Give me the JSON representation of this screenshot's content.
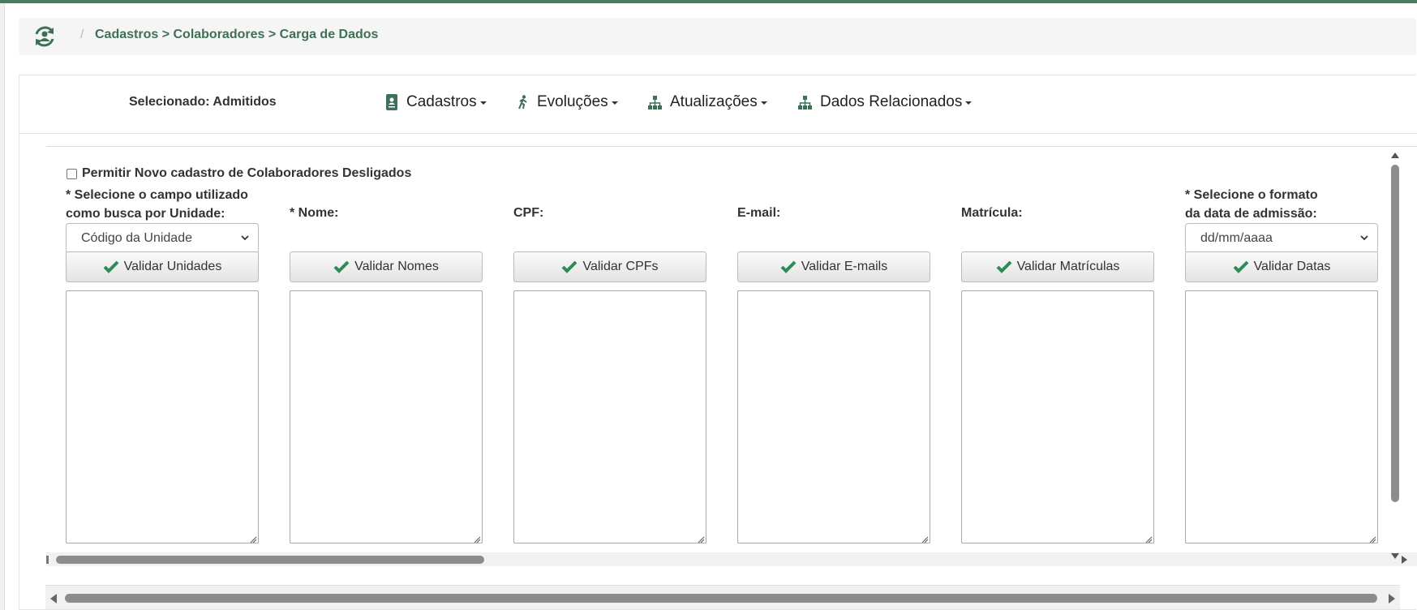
{
  "breadcrumb": {
    "separator": "/",
    "path": "Cadastros > Colaboradores > Carga de Dados"
  },
  "nav": {
    "selected_label": "Selecionado: Admitidos",
    "menus": [
      {
        "label": "Cadastros",
        "icon": "address-book-icon"
      },
      {
        "label": "Evoluções",
        "icon": "person-walking-icon"
      },
      {
        "label": "Atualizações",
        "icon": "sitemap-icon"
      },
      {
        "label": "Dados Relacionados",
        "icon": "sitemap-icon"
      }
    ]
  },
  "form": {
    "allow_dismissed_label": "Permitir Novo cadastro de Colaboradores Desligados",
    "allow_dismissed_checked": false,
    "columns": [
      {
        "label": "* Selecione o campo utilizado\ncomo busca por Unidade:",
        "select_value": "Código da Unidade",
        "button": "Validar Unidades",
        "textarea_value": ""
      },
      {
        "label": "* Nome:",
        "button": "Validar Nomes",
        "textarea_value": ""
      },
      {
        "label": "CPF:",
        "button": "Validar CPFs",
        "textarea_value": ""
      },
      {
        "label": "E-mail:",
        "button": "Validar E-mails",
        "textarea_value": ""
      },
      {
        "label": "Matrícula:",
        "button": "Validar Matrículas",
        "textarea_value": ""
      },
      {
        "label": "* Selecione o formato\nda data de admissão:",
        "select_value": "dd/mm/aaaa",
        "button": "Validar Datas",
        "textarea_value": ""
      }
    ]
  },
  "colors": {
    "accent": "#3f6f56",
    "check_green": "#2e8b57"
  }
}
